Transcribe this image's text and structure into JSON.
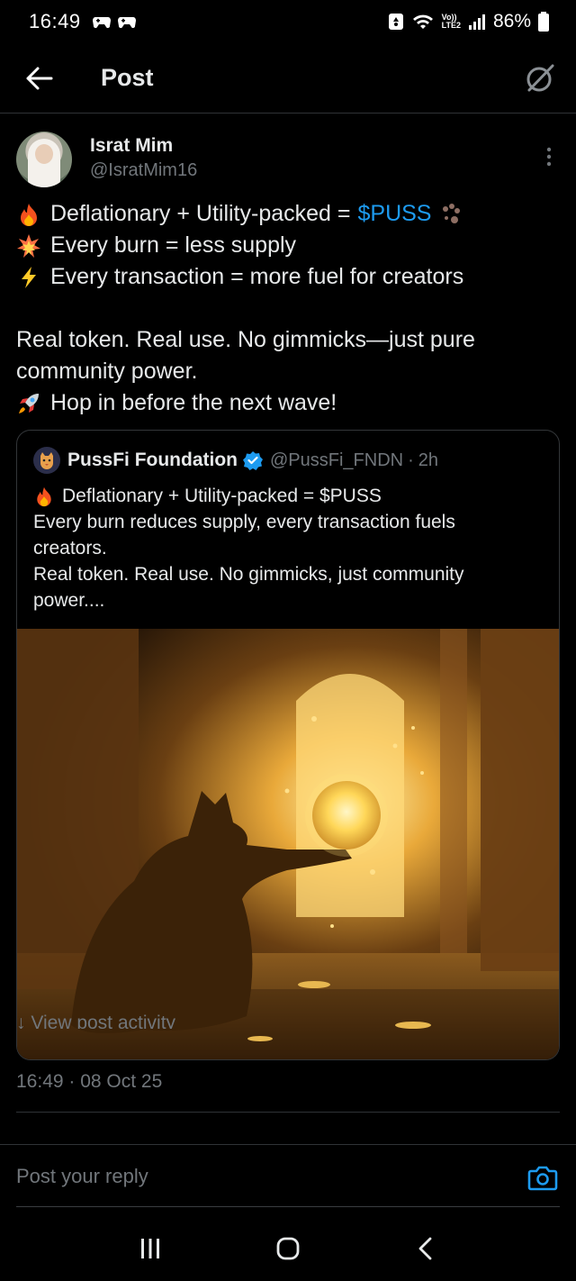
{
  "status_bar": {
    "time": "16:49",
    "battery": "86%",
    "network": "LTE2",
    "volte": "Vo))"
  },
  "header": {
    "title": "Post"
  },
  "post": {
    "author_name": "Israt Mim",
    "author_handle": "@IsratMim16",
    "line1": "Deflationary + Utility-packed =",
    "cashtag": "$PUSS",
    "line2": "Every burn = less supply",
    "line3": "Every transaction = more fuel for creators",
    "line4": "Real token. Real use. No gimmicks—just pure",
    "line5": "community power.",
    "line6": "Hop in before the next wave!",
    "timestamp": "16:49 · 08 Oct 25",
    "view_activity": "View post activity"
  },
  "quote": {
    "name": "PussFi Foundation",
    "handle": "@PussFi_FNDN",
    "dot": "·",
    "time": "2h",
    "line1": "Deflationary + Utility-packed = $PUSS",
    "line2": "Every burn reduces supply, every transaction fuels",
    "line3": "creators.",
    "line4": "Real token. Real use. No gimmicks, just community",
    "line5": "power...."
  },
  "reply": {
    "placeholder": "Post your reply"
  },
  "colors": {
    "accent": "#1d9bf0",
    "muted": "#71767b",
    "text": "#e7e9ea",
    "background": "#000000"
  },
  "icons": [
    "back-arrow-icon",
    "grok-icon",
    "more-icon",
    "fire-icon",
    "collision-icon",
    "lightning-icon",
    "rocket-icon",
    "paw-icon",
    "verified-icon",
    "camera-icon",
    "recents-icon",
    "home-icon",
    "back-icon"
  ]
}
